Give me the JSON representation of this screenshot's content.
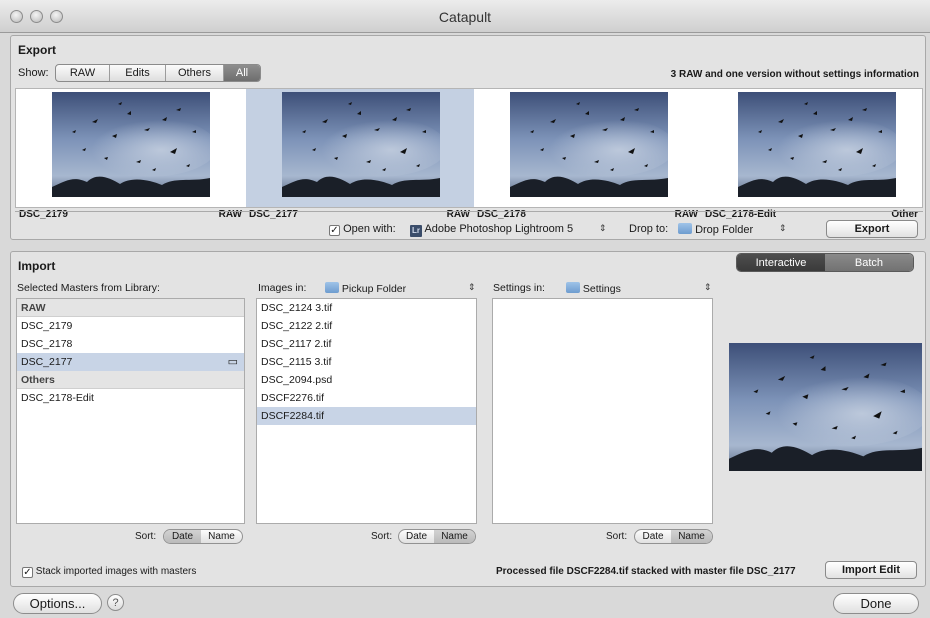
{
  "window": {
    "title": "Catapult"
  },
  "export": {
    "title": "Export",
    "show_label": "Show:",
    "filters": [
      "RAW",
      "Edits",
      "Others",
      "All"
    ],
    "selected_filter": "All",
    "info": "3 RAW and one version without settings information",
    "thumbs": [
      {
        "name": "DSC_2179",
        "type": "RAW",
        "selected": false
      },
      {
        "name": "DSC_2177",
        "type": "RAW",
        "selected": true
      },
      {
        "name": "DSC_2178",
        "type": "RAW",
        "selected": false
      },
      {
        "name": "DSC_2178-Edit",
        "type": "Other",
        "selected": false
      }
    ],
    "open_with_label": "Open with:",
    "open_with_checked": true,
    "app_icon": "Lr",
    "app_name": "Adobe Photoshop Lightroom 5",
    "drop_to_label": "Drop to:",
    "drop_folder": "Drop Folder",
    "export_button": "Export"
  },
  "import": {
    "title": "Import",
    "modes": [
      "Interactive",
      "Batch"
    ],
    "selected_mode": "Interactive",
    "masters_label": "Selected Masters from Library:",
    "masters": [
      {
        "label": "RAW",
        "group": true
      },
      {
        "label": "DSC_2179"
      },
      {
        "label": "DSC_2178"
      },
      {
        "label": "DSC_2177",
        "selected": true
      },
      {
        "label": "Others",
        "group": true
      },
      {
        "label": "DSC_2178-Edit"
      }
    ],
    "images_in_label": "Images in:",
    "images_folder": "Pickup Folder",
    "images": [
      "DSC_2124 3.tif",
      "DSC_2122 2.tif",
      "DSC_2117 2.tif",
      "DSC_2115 3.tif",
      "DSC_2094.psd",
      "DSCF2276.tif",
      "DSCF2284.tif"
    ],
    "selected_image_index": 6,
    "settings_in_label": "Settings in:",
    "settings_folder": "Settings",
    "sort_label": "Sort:",
    "sort_options": [
      "Date",
      "Name"
    ],
    "stack_label": "Stack imported images with masters",
    "stack_checked": true,
    "status": "Processed file DSCF2284.tif stacked with master file DSC_2177",
    "import_edit_button": "Import Edit"
  },
  "footer": {
    "options_button": "Options...",
    "help_icon": "?",
    "done_button": "Done"
  },
  "icons": [
    "close-icon",
    "minimize-icon",
    "zoom-icon",
    "checkbox-icon",
    "lightroom-icon",
    "folder-icon",
    "stepper-icon",
    "stack-icon",
    "help-icon"
  ]
}
